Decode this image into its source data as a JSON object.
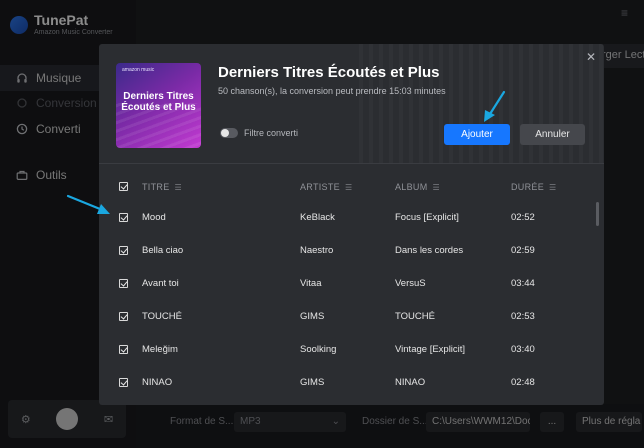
{
  "app": {
    "title": "TunePat",
    "subtitle": "Amazon Music Converter"
  },
  "sidebar": {
    "items": [
      {
        "label": "Musique",
        "icon": "headphones-icon",
        "active": true
      },
      {
        "label": "Conversion",
        "icon": "sync-icon",
        "disabled": true
      },
      {
        "label": "Converti",
        "icon": "clock-icon"
      },
      {
        "label": "Outils",
        "icon": "toolbox-icon"
      }
    ]
  },
  "background": {
    "import_label": "rger Lecteur",
    "bottom": {
      "format_label": "Format de S...",
      "format_value": "MP3",
      "folder_label": "Dossier de S...",
      "folder_value": "C:\\Users\\WWM12\\Doc",
      "more_label": "...",
      "settings_label": "Plus de régla"
    }
  },
  "modal": {
    "cover": {
      "brand": "amazon music",
      "text": "Derniers Titres Écoutés et Plus"
    },
    "title": "Derniers Titres Écoutés et Plus",
    "subtitle": "50 chanson(s), la conversion peut prendre 15:03 minutes",
    "filter_label": "Filtre converti",
    "add_label": "Ajouter",
    "cancel_label": "Annuler",
    "columns": {
      "title": "TITRE",
      "artist": "ARTISTE",
      "album": "ALBUM",
      "duration": "DURÉE"
    },
    "rows": [
      {
        "title": "Mood",
        "artist": "KeBlack",
        "album": "Focus [Explicit]",
        "duration": "02:52"
      },
      {
        "title": "Bella ciao",
        "artist": "Naestro",
        "album": "Dans les cordes",
        "duration": "02:59"
      },
      {
        "title": "Avant toi",
        "artist": "Vitaa",
        "album": "VersuS",
        "duration": "03:44"
      },
      {
        "title": "TOUCHÉ",
        "artist": "GIMS",
        "album": "TOUCHÉ",
        "duration": "02:53"
      },
      {
        "title": "Meleğim",
        "artist": "Soolking",
        "album": "Vintage [Explicit]",
        "duration": "03:40"
      },
      {
        "title": "NINAO",
        "artist": "GIMS",
        "album": "NINAO",
        "duration": "02:48"
      }
    ]
  },
  "colors": {
    "accent": "#1677ff",
    "annotation_arrow": "#1aa7e0"
  }
}
